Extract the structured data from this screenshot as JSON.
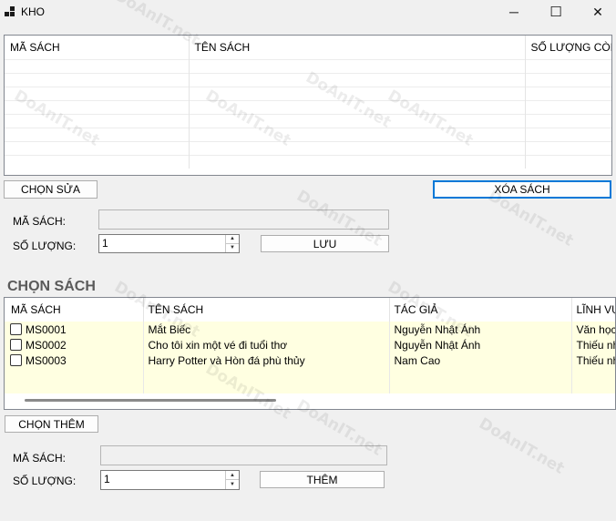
{
  "window": {
    "title": "KHO",
    "minimize_glyph": "─",
    "maximize_glyph": "☐",
    "close_glyph": "✕"
  },
  "top_grid": {
    "columns": [
      "MÃ SÁCH",
      "TÊN SÁCH",
      "SỐ LƯỢNG CÒN LẠI"
    ]
  },
  "top_actions": {
    "choose_edit": "CHỌN SỬA",
    "delete_book": "XÓA SÁCH"
  },
  "edit_form": {
    "book_id_label": "MÃ SÁCH:",
    "book_id_value": "",
    "quantity_label": "SỐ LƯỢNG:",
    "quantity_value": "1",
    "save_button": "LƯU"
  },
  "choose_section": {
    "title": "CHỌN SÁCH",
    "columns": [
      "MÃ SÁCH",
      "TÊN SÁCH",
      "TÁC GIẢ",
      "LĨNH VỰC"
    ],
    "rows": [
      {
        "id": "MS0001",
        "name": "Mắt Biếc",
        "author": "Nguyễn Nhật Ánh",
        "field": "Văn học"
      },
      {
        "id": "MS0002",
        "name": "Cho tôi xin một vé đi tuổi thơ",
        "author": "Nguyễn Nhật Ánh",
        "field": "Thiếu nhi"
      },
      {
        "id": "MS0003",
        "name": "Harry Potter và Hòn đá phù thủy",
        "author": "Nam Cao",
        "field": "Thiếu nhi"
      }
    ]
  },
  "add_actions": {
    "choose_add": "CHỌN THÊM"
  },
  "add_form": {
    "book_id_label": "MÃ SÁCH:",
    "book_id_value": "",
    "quantity_label": "SỐ LƯỢNG:",
    "quantity_value": "1",
    "add_button": "THÊM"
  },
  "icons": {
    "app": "app-grid-icon",
    "spin_up": "▲",
    "spin_down": "▼"
  },
  "colors": {
    "grid_row_highlight": "#ffffe1",
    "focus_border": "#0078d7",
    "section_title": "#5a5a5a"
  }
}
